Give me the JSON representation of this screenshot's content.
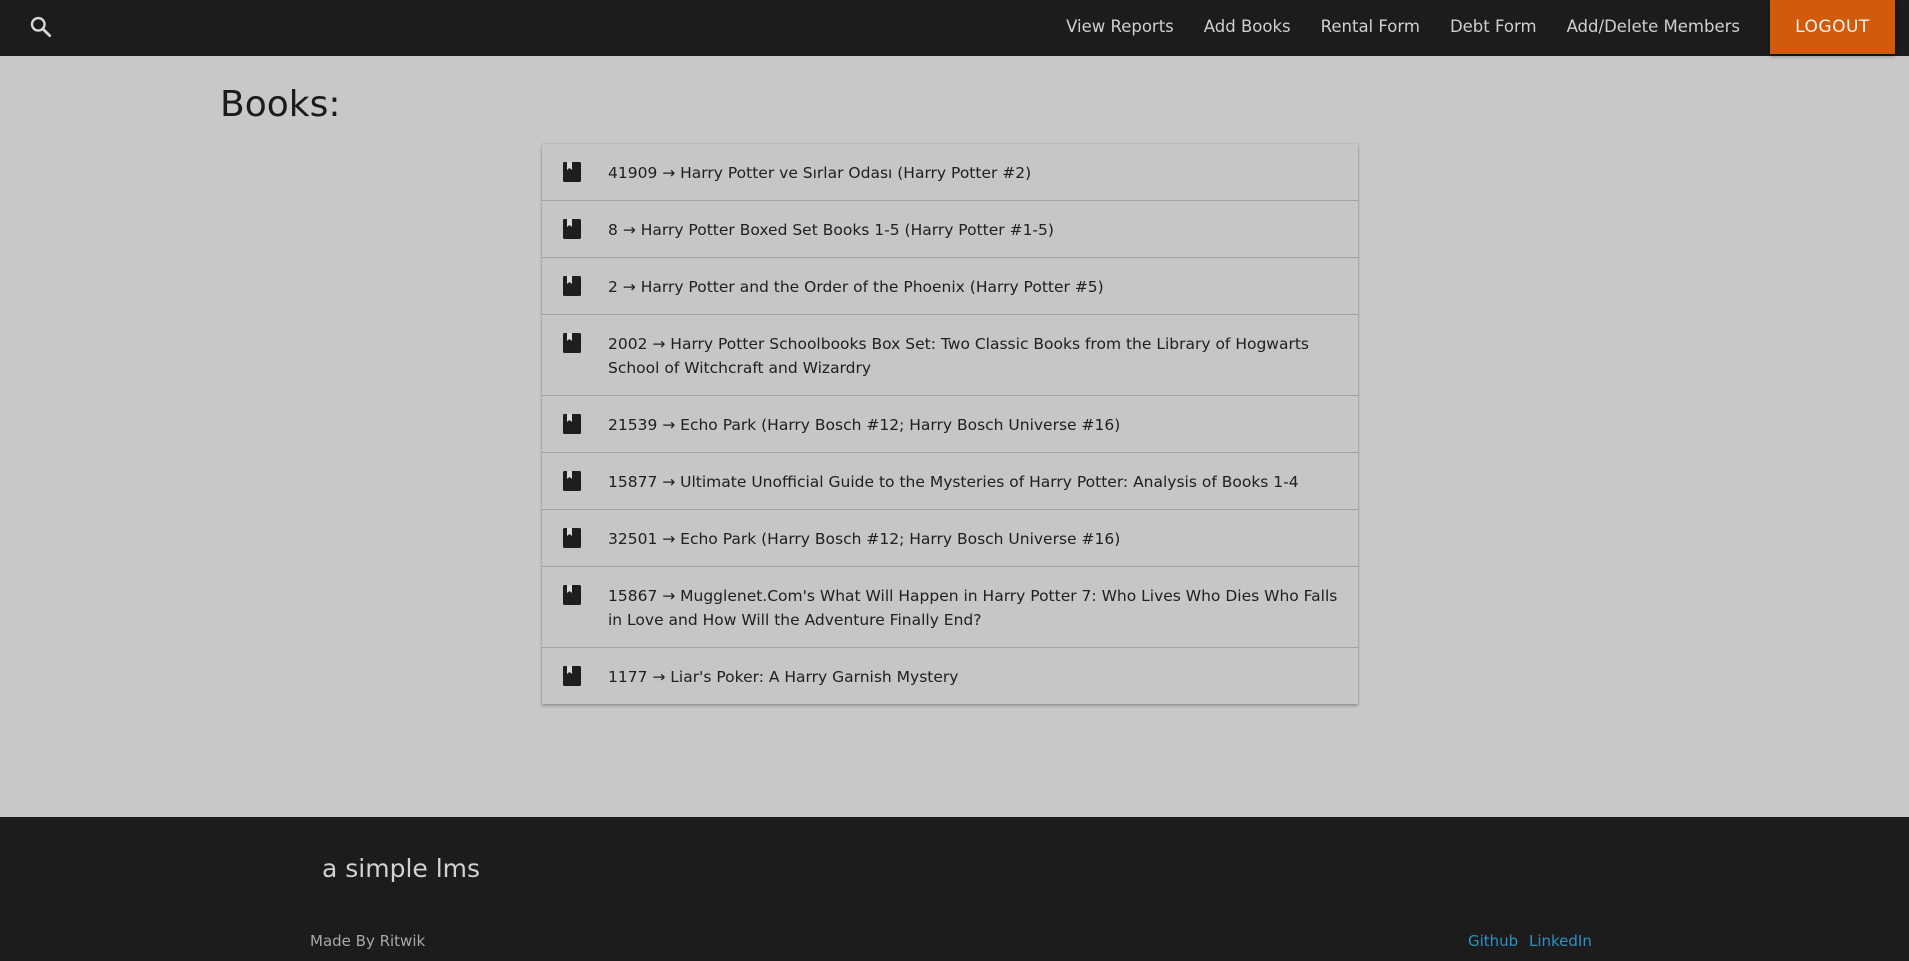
{
  "navbar": {
    "search_icon": "search-icon",
    "links": [
      {
        "label": "View Reports"
      },
      {
        "label": "Add Books"
      },
      {
        "label": "Rental Form"
      },
      {
        "label": "Debt Form"
      },
      {
        "label": "Add/Delete Members"
      }
    ],
    "logout_label": "LOGOUT",
    "logout_color": "#d15b0b",
    "background_color": "#1c1c1c"
  },
  "main": {
    "title": "Books:",
    "book_icon": "book-icon",
    "books": [
      {
        "text": "41909 → Harry Potter ve Sırlar Odası (Harry Potter #2)"
      },
      {
        "text": "8 → Harry Potter Boxed Set Books 1-5 (Harry Potter #1-5)"
      },
      {
        "text": "2 → Harry Potter and the Order of the Phoenix (Harry Potter #5)"
      },
      {
        "text": "2002 → Harry Potter Schoolbooks Box Set: Two Classic Books from the Library of Hogwarts School of Witchcraft and Wizardry"
      },
      {
        "text": "21539 → Echo Park (Harry Bosch #12; Harry Bosch Universe #16)"
      },
      {
        "text": "15877 → Ultimate Unofficial Guide to the Mysteries of Harry Potter: Analysis of Books 1-4"
      },
      {
        "text": "32501 → Echo Park (Harry Bosch #12; Harry Bosch Universe #16)"
      },
      {
        "text": "15867 → Mugglenet.Com's What Will Happen in Harry Potter 7: Who Lives Who Dies Who Falls in Love and How Will the Adventure Finally End?"
      },
      {
        "text": "1177 → Liar's Poker: A Harry Garnish Mystery"
      }
    ]
  },
  "footer": {
    "title": "a simple lms",
    "credit": "Made By Ritwik",
    "links": [
      {
        "label": "Github"
      },
      {
        "label": "LinkedIn"
      }
    ],
    "link_color": "#2f8fc6"
  }
}
